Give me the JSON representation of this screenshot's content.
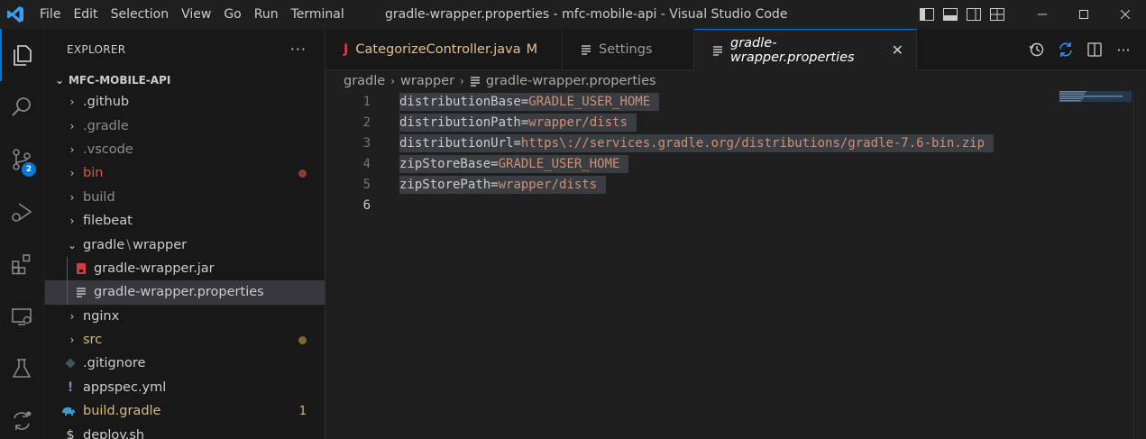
{
  "titlebar": {
    "menu": [
      "File",
      "Edit",
      "Selection",
      "View",
      "Go",
      "Run",
      "Terminal"
    ],
    "window_title": "gradle-wrapper.properties - mfc-mobile-api - Visual Studio Code"
  },
  "activitybar": {
    "items": [
      "explorer-icon",
      "search-icon",
      "source-control-icon",
      "run-debug-icon",
      "extensions-icon",
      "remote-explorer-icon",
      "testing-icon",
      "git-diff-icon"
    ],
    "scm_badge": "2"
  },
  "sidebar": {
    "title": "EXPLORER",
    "more": "···",
    "root": "MFC-MOBILE-API",
    "items": [
      {
        "label": ".github",
        "type": "folder",
        "color": "#cccccc"
      },
      {
        "label": ".gradle",
        "type": "folder",
        "color": "#8c8c8c"
      },
      {
        "label": ".vscode",
        "type": "folder",
        "color": "#8c8c8c"
      },
      {
        "label": "bin",
        "type": "folder",
        "color": "#e5533d",
        "dot": "#8c3a3a"
      },
      {
        "label": "build",
        "type": "folder",
        "color": "#8c8c8c"
      },
      {
        "label": "filebeat",
        "type": "folder",
        "color": "#cccccc"
      },
      {
        "label": "gradle",
        "label2": "wrapper",
        "type": "folder-open",
        "color": "#cccccc"
      },
      {
        "label": "gradle-wrapper.jar",
        "type": "file",
        "color": "#cccccc"
      },
      {
        "label": "gradle-wrapper.properties",
        "type": "file",
        "color": "#cccccc"
      },
      {
        "label": "nginx",
        "type": "folder",
        "color": "#cccccc"
      },
      {
        "label": "src",
        "type": "folder",
        "color": "#d7ba7d",
        "dot": "#7a6a2d"
      },
      {
        "label": ".gitignore",
        "type": "file",
        "color": "#cccccc"
      },
      {
        "label": "appspec.yml",
        "type": "file",
        "color": "#cccccc"
      },
      {
        "label": "build.gradle",
        "type": "file",
        "color": "#d7ba7d",
        "count": "1"
      },
      {
        "label": "deploy.sh",
        "type": "file",
        "color": "#cccccc"
      }
    ]
  },
  "tabs": [
    {
      "label": "CategorizeController.java",
      "modified": "M"
    },
    {
      "label": "Settings"
    },
    {
      "label": "gradle-wrapper.properties",
      "close": "✕"
    }
  ],
  "breadcrumb": [
    "gradle",
    "wrapper",
    "gradle-wrapper.properties"
  ],
  "editor": {
    "lines": [
      {
        "n": "1",
        "key": "distributionBase",
        "eq": "=",
        "val": "GRADLE_USER_HOME"
      },
      {
        "n": "2",
        "key": "distributionPath",
        "eq": "=",
        "val": "wrapper/dists"
      },
      {
        "n": "3",
        "key": "distributionUrl",
        "eq": "=",
        "val": "https\\://services.gradle.org/distributions/gradle-7.6-bin.zip"
      },
      {
        "n": "4",
        "key": "zipStoreBase",
        "eq": "=",
        "val": "GRADLE_USER_HOME"
      },
      {
        "n": "5",
        "key": "zipStorePath",
        "eq": "=",
        "val": "wrapper/dists"
      },
      {
        "n": "6",
        "key": "",
        "eq": "",
        "val": ""
      }
    ]
  }
}
